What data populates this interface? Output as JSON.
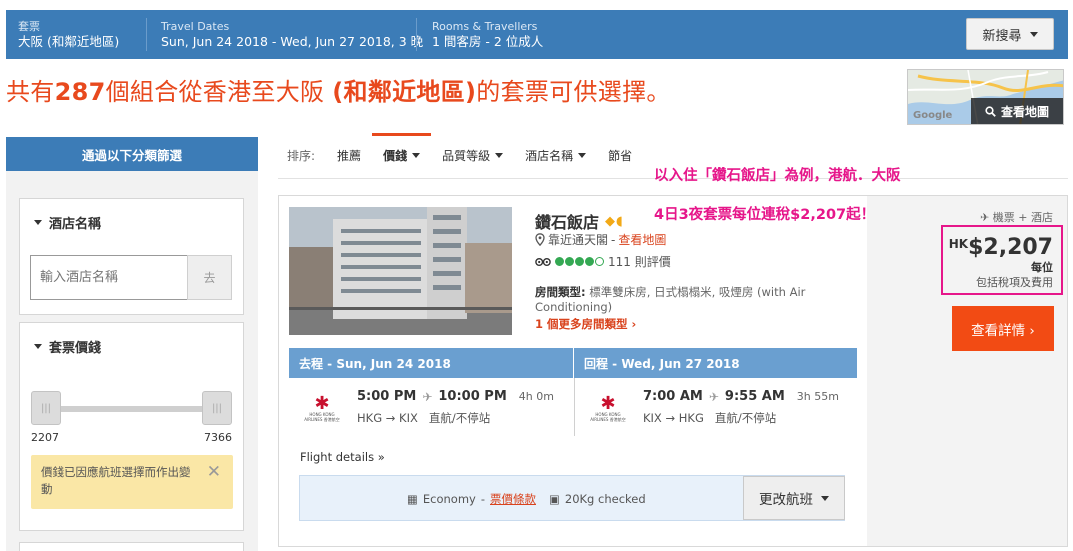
{
  "search_summary": {
    "package_label": "套票",
    "package_value": "大阪 (和鄰近地區)",
    "dates_label": "Travel Dates",
    "dates_value": "Sun, Jun 24 2018 - Wed, Jun 27 2018, 3 晚",
    "rooms_label": "Rooms & Travellers",
    "rooms_value": "1 間客房 - 2 位成人",
    "new_search_label": "新搜尋"
  },
  "headline": {
    "prefix": "共有",
    "count": "287",
    "middle": "個組合從香港至大阪 ",
    "bold_part": "(和鄰近地區)",
    "suffix": "的套票可供選擇。"
  },
  "map": {
    "button_label": "查看地圖",
    "logo_text": "Google"
  },
  "filters": {
    "header": "通過以下分類篩選",
    "hotel_name_title": "酒店名稱",
    "hotel_name_placeholder": "輸入酒店名稱",
    "go_label": "去",
    "price_title": "套票價錢",
    "price_min": "2207",
    "price_max": "7366",
    "price_notice": "價錢已因應航班選擇而作出變動",
    "handle_glyph": "|||"
  },
  "sort": {
    "label": "排序:",
    "options": [
      "推薦",
      "價錢",
      "品質等級",
      "酒店名稱",
      "節省"
    ],
    "active": "價錢"
  },
  "annotation": {
    "line1": "以入住「鑽石飯店」為例，港航．大阪",
    "line2": "4日3夜套票每位連稅$2,207起！"
  },
  "hotel": {
    "name": "鑽石飯店",
    "star_glyphs": "◆◖",
    "location": "靠近通天閣",
    "location_sep": " - ",
    "map_link": "查看地圖",
    "review_count": "111 則評價",
    "rating": 4,
    "rating_max": 5,
    "room_type_label": "房間類型:",
    "room_type_value": " 標準雙床房, 日式榻榻米, 吸煙房 (with Air Conditioning)",
    "more_rooms": "1 個更多房間類型 ›"
  },
  "price": {
    "package_type": "機票 + 酒店",
    "currency": "HK",
    "amount": "$2,207",
    "per_person": "每位",
    "tax_note": "包括稅項及費用",
    "details_button": "查看詳情 ›"
  },
  "flights": {
    "outbound": {
      "header": "去程 - Sun, Jun 24 2018",
      "depart": "5:00 PM",
      "arrive": "10:00 PM",
      "duration": "4h 0m",
      "route": "HKG → KIX",
      "stops": "直航/不停站",
      "airline_name": "HONG KONG AIRLINES 香港航空"
    },
    "return": {
      "header": "回程 - Wed, Jun 27 2018",
      "depart": "7:00 AM",
      "arrive": "9:55 AM",
      "duration": "3h 55m",
      "route": "KIX → HKG",
      "stops": "直航/不停站",
      "airline_name": "HONG KONG AIRLINES 香港航空"
    },
    "details_label": "Flight details »",
    "fare_class": "Economy",
    "fare_sep": " - ",
    "fare_rules_link": "票價條款",
    "baggage": "20Kg checked",
    "change_flight_label": "更改航班"
  },
  "colors": {
    "brand_blue": "#3c7cb7",
    "flight_header_blue": "#6a9fd0",
    "accent_orange": "#e8491d",
    "cta_orange": "#f24b14",
    "annotation_pink": "#e6168a"
  }
}
